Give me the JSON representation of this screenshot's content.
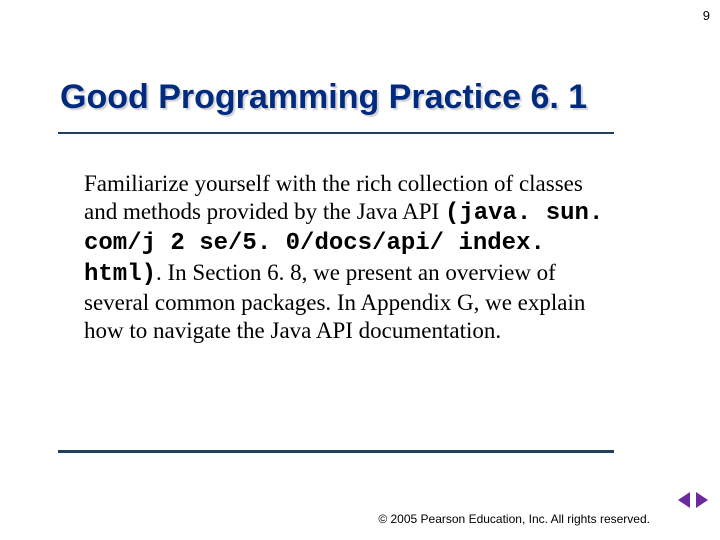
{
  "page_number": "9",
  "title": "Good Programming Practice 6. 1",
  "body": {
    "part1": "Familiarize yourself with the rich collection of classes and methods provided by the Java API ",
    "mono": "(java. sun. com/j 2 se/5. 0/docs/api/ index. html)",
    "part2": ". In Section 6. 8, we present an overview of several common packages. In Appendix G, we explain how to navigate the Java API documentation."
  },
  "footer": {
    "copyright_symbol": "©",
    "text": " 2005 Pearson Education, Inc. All rights reserved."
  }
}
